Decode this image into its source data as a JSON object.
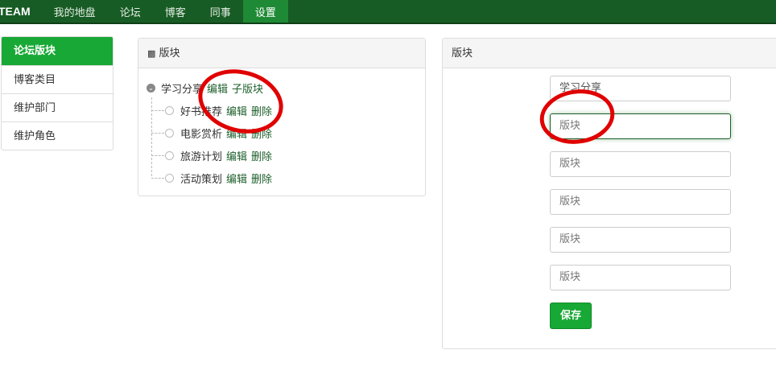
{
  "nav": {
    "brand": "TEAM",
    "items": [
      "我的地盘",
      "论坛",
      "博客",
      "同事",
      "设置"
    ],
    "active": 4
  },
  "sidebar": {
    "items": [
      "论坛版块",
      "博客类目",
      "维护部门",
      "维护角色"
    ]
  },
  "tree_panel": {
    "title": "版块",
    "root": {
      "label": "学习分享",
      "edit": "编辑",
      "add_child": "子版块"
    },
    "children": [
      {
        "label": "好书推荐",
        "edit": "编辑",
        "delete": "删除"
      },
      {
        "label": "电影赏析",
        "edit": "编辑",
        "delete": "删除"
      },
      {
        "label": "旅游计划",
        "edit": "编辑",
        "delete": "删除"
      },
      {
        "label": "活动策划",
        "edit": "编辑",
        "delete": "删除"
      }
    ]
  },
  "form_panel": {
    "title": "版块",
    "first_value": "学习分享",
    "placeholder": "版块",
    "save": "保存"
  },
  "colors": {
    "nav": "#175c24",
    "accent": "#18a835",
    "annotation": "#e00000"
  }
}
